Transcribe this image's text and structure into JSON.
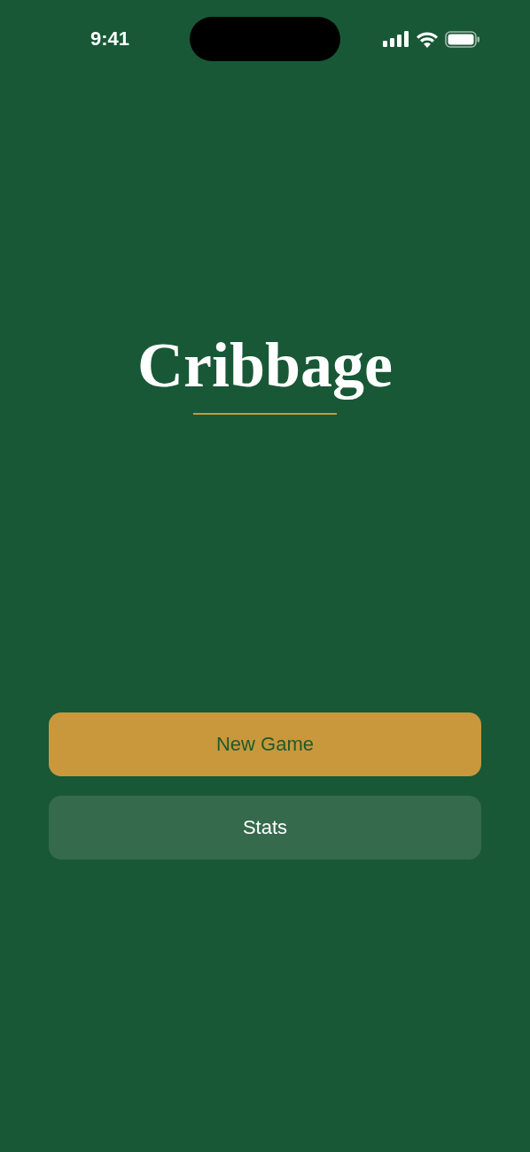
{
  "status_bar": {
    "time": "9:41"
  },
  "title": "Cribbage",
  "buttons": [
    {
      "label": "New Game",
      "kind": "primary"
    },
    {
      "label": "Stats",
      "kind": "secondary"
    }
  ]
}
